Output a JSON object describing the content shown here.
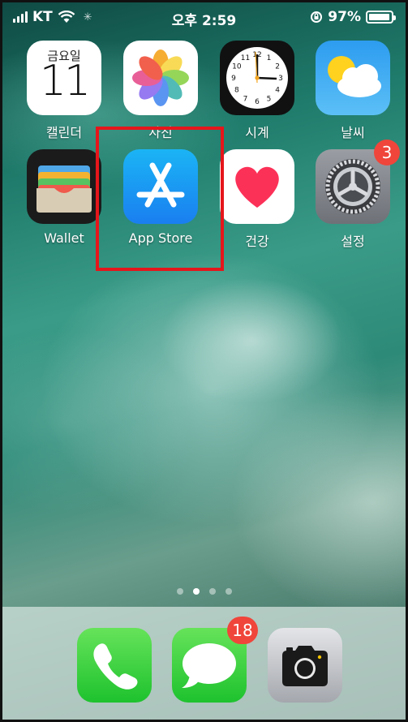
{
  "status_bar": {
    "carrier": "KT",
    "time": "오후 2:59",
    "battery_percent": "97%",
    "battery_level": 0.97
  },
  "apps": {
    "calendar": {
      "label": "캘린더",
      "weekday": "금요일",
      "day": "11"
    },
    "photos": {
      "label": "사진"
    },
    "clock": {
      "label": "시계",
      "numbers": [
        "12",
        "1",
        "2",
        "3",
        "4",
        "5",
        "6",
        "7",
        "8",
        "9",
        "10",
        "11"
      ]
    },
    "weather": {
      "label": "날씨"
    },
    "wallet": {
      "label": "Wallet"
    },
    "app_store": {
      "label": "App Store"
    },
    "health": {
      "label": "건강"
    },
    "settings": {
      "label": "설정",
      "badge": "3"
    }
  },
  "page_indicator": {
    "pages": 4,
    "current": 2
  },
  "dock": {
    "phone": {
      "name": "phone-icon"
    },
    "messages": {
      "name": "messages-icon",
      "badge": "18"
    },
    "camera": {
      "name": "camera-icon"
    }
  },
  "colors": {
    "highlight": "#e5161b",
    "badge": "#f0453a"
  }
}
